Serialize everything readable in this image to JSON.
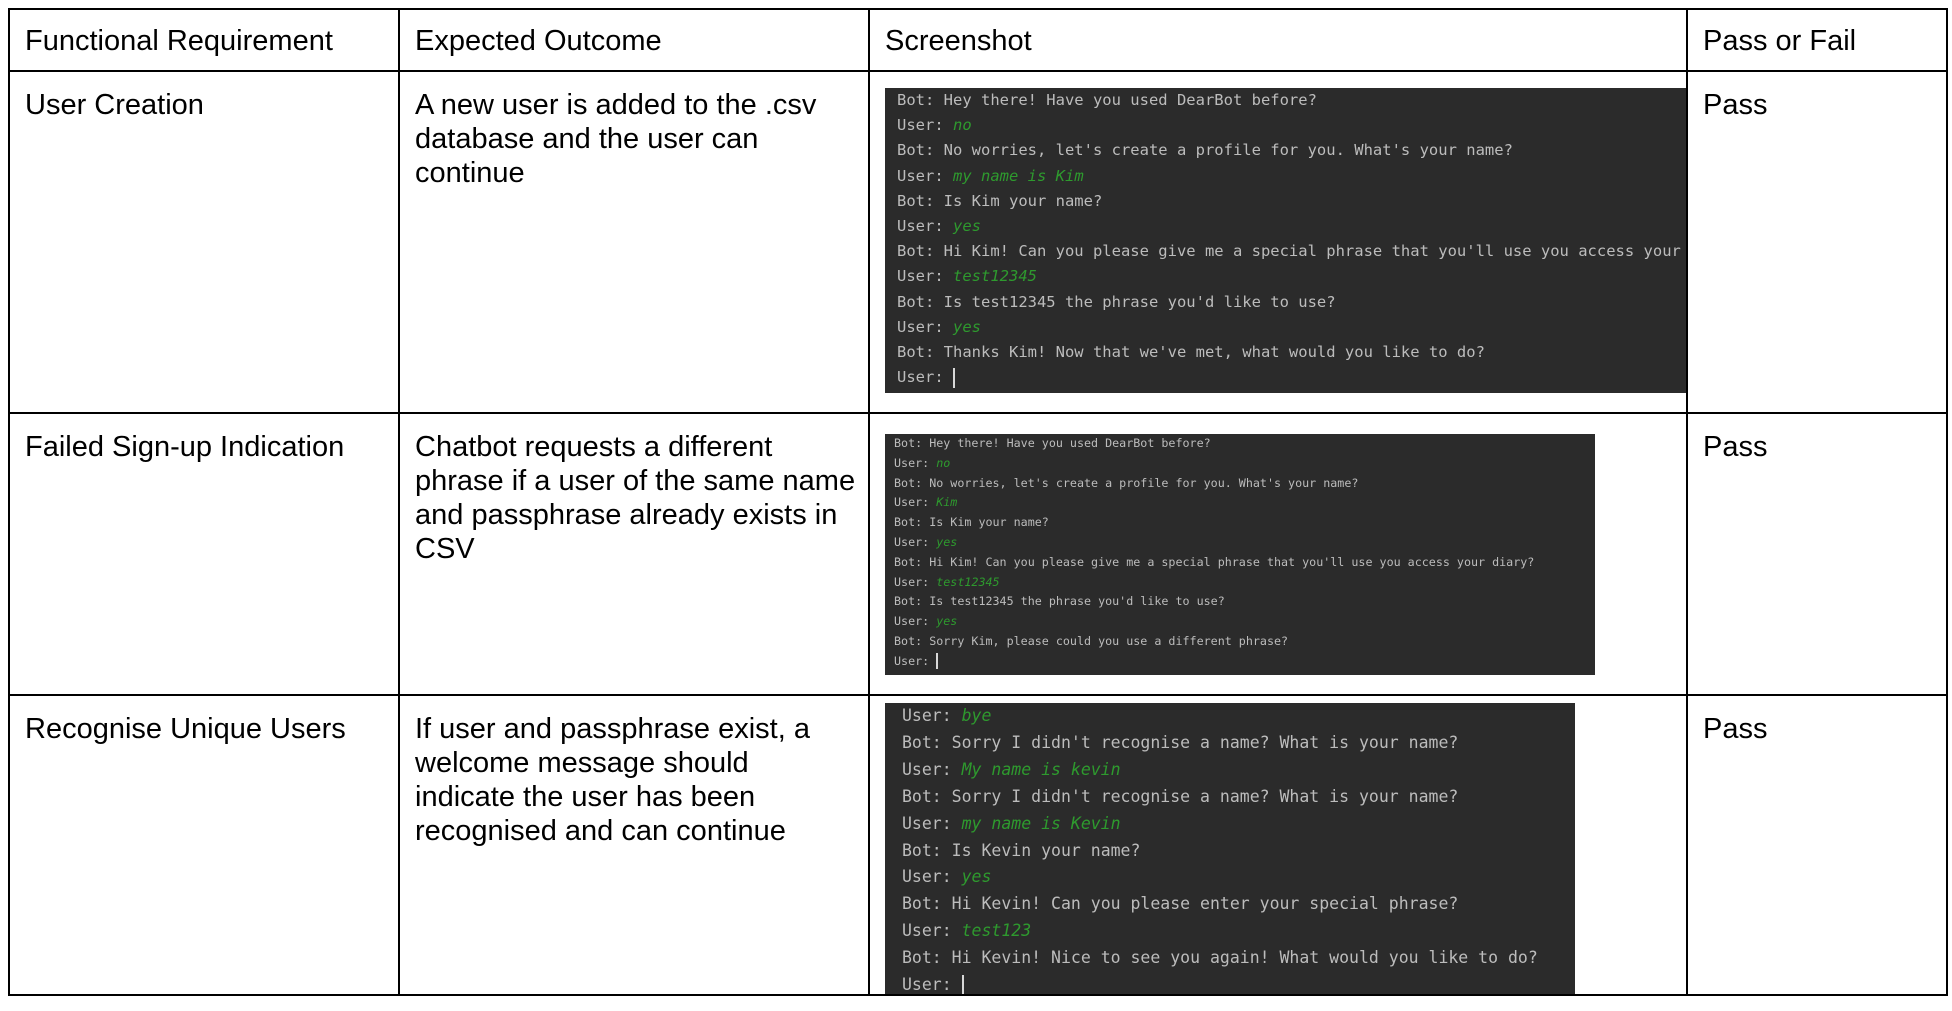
{
  "headers": [
    "Functional Requirement",
    "Expected Outcome",
    "Screenshot",
    "Pass or Fail"
  ],
  "rows": [
    {
      "requirement": "User Creation",
      "outcome": "A new user is added to the .csv database and the user can continue",
      "result": "Pass",
      "terminal": [
        {
          "speaker": "Bot:",
          "text": " Hey there! Have you used DearBot before?"
        },
        {
          "speaker": "User:",
          "input": "no"
        },
        {
          "speaker": "Bot:",
          "text": " No worries, let's create a profile for you. What's your name?"
        },
        {
          "speaker": "User:",
          "input": "my name is Kim"
        },
        {
          "speaker": "Bot:",
          "text": " Is Kim your name?"
        },
        {
          "speaker": "User:",
          "input": "yes"
        },
        {
          "speaker": "Bot:",
          "text": " Hi Kim! Can you please give me a special phrase that you'll use you access your di"
        },
        {
          "speaker": "User:",
          "input": "test12345"
        },
        {
          "speaker": "Bot:",
          "text": " Is test12345 the phrase you'd like to use?"
        },
        {
          "speaker": "User:",
          "input": "yes"
        },
        {
          "speaker": "Bot:",
          "text": " Thanks Kim! Now that we've met, what would you like to do?"
        },
        {
          "speaker": "User:",
          "cursor": true
        }
      ]
    },
    {
      "requirement": "Failed Sign-up Indication",
      "outcome": "Chatbot requests a different phrase if a user of the same name and passphrase already exists in CSV",
      "result": "Pass",
      "terminal": [
        {
          "speaker": "Bot:",
          "text": " Hey there! Have you used DearBot before?"
        },
        {
          "speaker": "User:",
          "input": "no"
        },
        {
          "speaker": "Bot:",
          "text": " No worries, let's create a profile for you. What's your name?"
        },
        {
          "speaker": "User:",
          "input": "Kim"
        },
        {
          "speaker": "Bot:",
          "text": " Is Kim your name?"
        },
        {
          "speaker": "User:",
          "input": "yes"
        },
        {
          "speaker": "Bot:",
          "text": " Hi Kim! Can you please give me a special phrase that you'll use you access your diary?"
        },
        {
          "speaker": "User:",
          "input": "test12345"
        },
        {
          "speaker": "Bot:",
          "text": " Is test12345 the phrase you'd like to use?"
        },
        {
          "speaker": "User:",
          "input": "yes"
        },
        {
          "speaker": "Bot:",
          "text": " Sorry Kim, please could you use a different phrase?"
        },
        {
          "speaker": "User:",
          "cursor": true
        }
      ]
    },
    {
      "requirement": "Recognise Unique Users",
      "outcome": "If user and passphrase exist, a welcome message should indicate the user has been recognised and can continue",
      "result": "Pass",
      "terminal": [
        {
          "speaker": "User:",
          "input": "bye"
        },
        {
          "speaker": "Bot:",
          "text": " Sorry I didn't recognise a name? What is your name?"
        },
        {
          "speaker": "User:",
          "input": "My name is kevin"
        },
        {
          "speaker": "Bot:",
          "text": " Sorry I didn't recognise a name? What is your name?"
        },
        {
          "speaker": "User:",
          "input": "my name is Kevin"
        },
        {
          "speaker": "Bot:",
          "text": " Is Kevin your name?"
        },
        {
          "speaker": "User:",
          "input": "yes"
        },
        {
          "speaker": "Bot:",
          "text": " Hi Kevin! Can you please enter your special phrase?"
        },
        {
          "speaker": "User:",
          "input": "test123"
        },
        {
          "speaker": "Bot:",
          "text": " Hi Kevin! Nice to see you again! What would you like to do?"
        },
        {
          "speaker": "User:",
          "cursor": true
        }
      ]
    }
  ]
}
